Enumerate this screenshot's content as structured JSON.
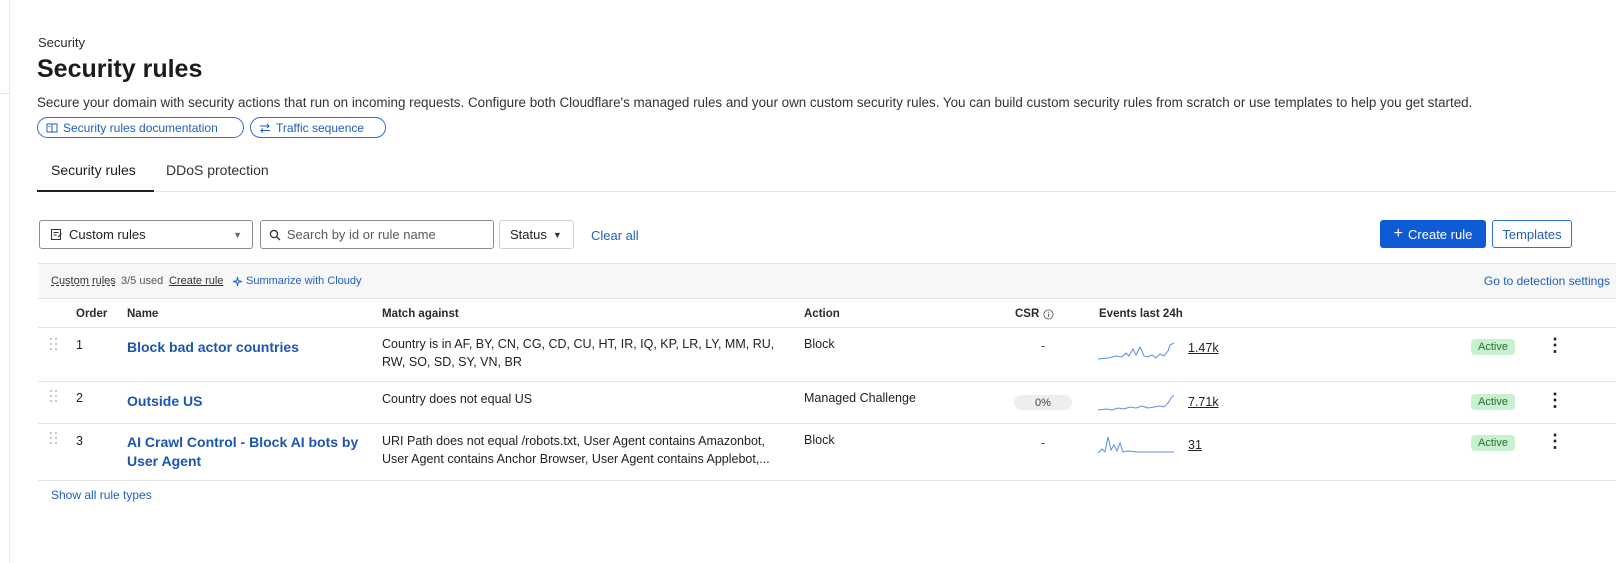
{
  "page": {
    "breadcrumb": "Security",
    "title": "Security rules",
    "description": "Secure your domain with security actions that run on incoming requests. Configure both Cloudflare's managed rules and your own custom security rules. You can build custom security rules from scratch or use templates to help you get started.",
    "links": {
      "docs": "Security rules documentation",
      "traffic": "Traffic sequence"
    }
  },
  "tabs": [
    {
      "label": "Security rules",
      "active": true
    },
    {
      "label": "DDoS protection",
      "active": false
    }
  ],
  "filters": {
    "rule_type": "Custom rules",
    "search_placeholder": "Search by id or rule name",
    "status": "Status",
    "clear_all": "Clear all"
  },
  "actions": {
    "create_rule": "Create rule",
    "templates": "Templates"
  },
  "toolbar": {
    "custom_rules": "Custom rules",
    "used": "3/5 used",
    "create_rule": "Create rule",
    "summarize": "Summarize with Cloudy",
    "detection_settings": "Go to detection settings"
  },
  "table": {
    "columns": [
      "Order",
      "Name",
      "Match against",
      "Action",
      "CSR",
      "Events last 24h"
    ],
    "rows": [
      {
        "order": "1",
        "name": "Block bad actor countries",
        "match": "Country is in AF, BY, CN, CG, CD, CU, HT, IR, IQ, KP, LR, LY, MM, RU, RW, SO, SD, SY, VN, BR",
        "action": "Block",
        "csr": "-",
        "events": "1.47k",
        "status": "Active"
      },
      {
        "order": "2",
        "name": "Outside US",
        "match": "Country does not equal US",
        "action": "Managed Challenge",
        "csr": "0%",
        "events": "7.71k",
        "status": "Active"
      },
      {
        "order": "3",
        "name": "AI Crawl Control - Block AI bots by User Agent",
        "match": "URI Path does not equal /robots.txt, User Agent contains Amazonbot, User Agent contains Anchor Browser, User Agent contains Applebot,...",
        "action": "Block",
        "csr": "-",
        "events": "31",
        "status": "Active"
      }
    ]
  },
  "footer": {
    "show_all": "Show all rule types"
  },
  "colors": {
    "primary": "#0f5bd6",
    "link": "#1f5fbf",
    "active_badge_bg": "#c8f1cf",
    "sparkline": "#5a8fe0"
  },
  "icons": {
    "docs": "book-icon",
    "traffic": "sequence-icon",
    "rule_type": "custom-rules-icon",
    "search": "search-icon",
    "create": "plus-icon",
    "summarize": "sparkle-icon",
    "csr_info": "info-icon",
    "row_menu": "kebab-icon",
    "drag": "drag-handle-icon"
  }
}
